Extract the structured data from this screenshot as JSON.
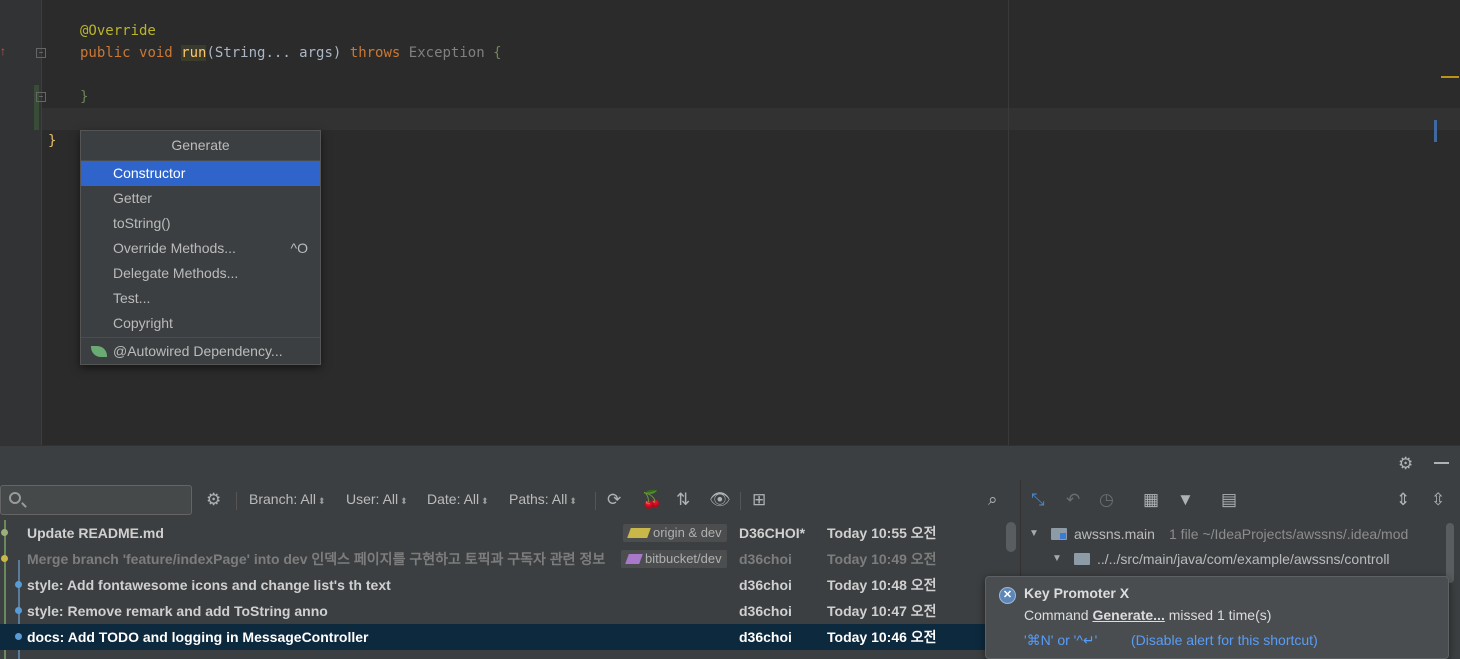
{
  "editor": {
    "lines": {
      "annotation": "@Override",
      "sig_public": "public",
      "sig_void": "void",
      "sig_name": "run",
      "sig_params": "(String... args)",
      "sig_throws": "throws",
      "sig_exception": "Exception",
      "sig_brace": "{",
      "close_method": "}",
      "close_class": "}"
    }
  },
  "generate_popup": {
    "title": "Generate",
    "items": [
      {
        "label": "Constructor",
        "shortcut": "",
        "selected": true
      },
      {
        "label": "Getter",
        "shortcut": ""
      },
      {
        "label": "toString()",
        "shortcut": ""
      },
      {
        "label": "Override Methods...",
        "shortcut": "^O"
      },
      {
        "label": "Delegate Methods...",
        "shortcut": ""
      },
      {
        "label": "Test...",
        "shortcut": ""
      },
      {
        "label": "Copyright",
        "shortcut": ""
      }
    ],
    "extra_item": "@Autowired Dependency..."
  },
  "git_log": {
    "filters": {
      "branch": "Branch: All",
      "user": "User: All",
      "date": "Date: All",
      "paths": "Paths: All"
    },
    "commits": [
      {
        "message": "Update README.md",
        "tag": "origin & dev",
        "author": "D36CHOI*",
        "date": "Today 10:55 오전"
      },
      {
        "message": "Merge branch 'feature/indexPage' into dev 인덱스 페이지를 구현하고 토픽과 구독자 관련 정보",
        "tag": "bitbucket/dev",
        "author": "d36choi",
        "date": "Today 10:49 오전"
      },
      {
        "message": "style: Add fontawesome icons and change list's th text",
        "author": "d36choi",
        "date": "Today 10:48 오전"
      },
      {
        "message": "style: Remove remark and add ToString anno",
        "author": "d36choi",
        "date": "Today 10:47 오전"
      },
      {
        "message": "docs: Add TODO and logging in MessageController",
        "author": "d36choi",
        "date": "Today 10:46 오전"
      }
    ]
  },
  "changes_tree": {
    "module": "awssns.main",
    "module_info": "1 file  ~/IdeaProjects/awssns/.idea/mod",
    "path": "../../src/main/java/com/example/awssns/controll"
  },
  "key_promoter": {
    "title": "Key Promoter X",
    "line_prefix": "Command ",
    "command": "Generate...",
    "line_suffix": " missed 1 time(s)",
    "shortcut": "'⌘N' or '^↵'",
    "disable_link": "(Disable alert for this shortcut)"
  }
}
